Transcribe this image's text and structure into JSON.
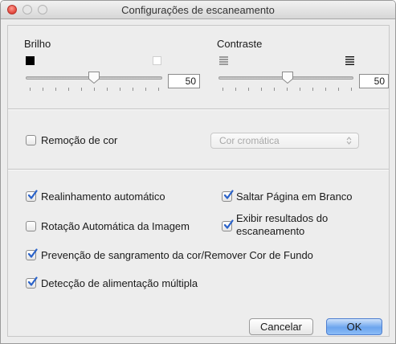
{
  "window": {
    "title": "Configurações de escaneamento"
  },
  "brightness": {
    "label": "Brilho",
    "value": "50"
  },
  "contrast": {
    "label": "Contraste",
    "value": "50"
  },
  "color_removal": {
    "label": "Remoção de cor",
    "checked": false,
    "select_value": "Cor cromática"
  },
  "options": {
    "auto_deskew": {
      "label": "Realinhamento automático",
      "checked": true
    },
    "skip_blank": {
      "label": "Saltar Página em Branco",
      "checked": true
    },
    "auto_rotate": {
      "label": "Rotação Automática da Imagem",
      "checked": false
    },
    "show_results": {
      "label_line1": "Exibir resultados do",
      "label_line2": "escaneamento",
      "checked": true
    },
    "bleed_through": {
      "label": "Prevenção de sangramento da cor/Remover Cor de Fundo",
      "checked": true
    },
    "multifeed": {
      "label": "Detecção de alimentação múltipla",
      "checked": true
    }
  },
  "buttons": {
    "cancel": "Cancelar",
    "ok": "OK"
  },
  "colors": {
    "accent": "#6ca5ee",
    "check": "#2a62c9",
    "close": "#e0443a"
  }
}
